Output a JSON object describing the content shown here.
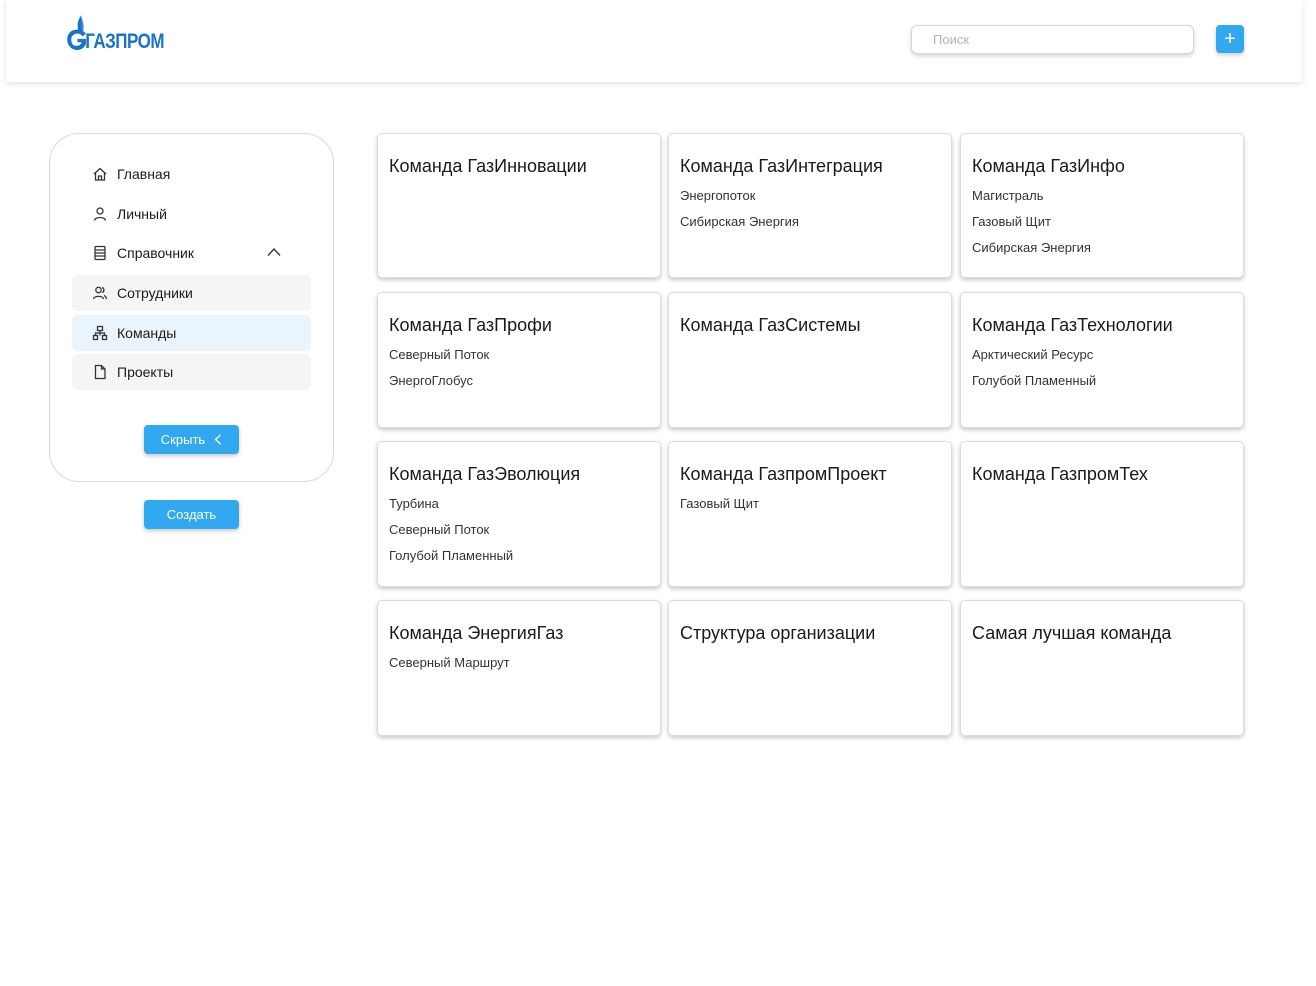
{
  "header": {
    "logo_text": "ГАЗПРОМ",
    "search_placeholder": "Поиск",
    "add_label": "+"
  },
  "sidebar": {
    "items": [
      {
        "label": "Главная",
        "icon": "home-icon"
      },
      {
        "label": "Личный",
        "icon": "user-icon"
      },
      {
        "label": "Справочник",
        "icon": "directory-icon",
        "expanded": true
      },
      {
        "label": "Сотрудники",
        "icon": "employees-icon"
      },
      {
        "label": "Команды",
        "icon": "teams-icon",
        "active": true
      },
      {
        "label": "Проекты",
        "icon": "file-icon"
      }
    ],
    "hide_label": "Скрыть",
    "create_label": "Создать"
  },
  "cards": [
    {
      "title": "Команда ГазИнновации",
      "items": []
    },
    {
      "title": "Команда ГазИнтеграция",
      "items": [
        "Энергопоток",
        "Сибирская Энергия"
      ]
    },
    {
      "title": "Команда ГазИнфо",
      "items": [
        "Магистраль",
        "Газовый Щит",
        "Сибирская Энергия"
      ]
    },
    {
      "title": "Команда ГазПрофи",
      "items": [
        "Северный Поток",
        "ЭнергоГлобус"
      ]
    },
    {
      "title": "Команда ГазСистемы",
      "items": []
    },
    {
      "title": "Команда ГазТехнологии",
      "items": [
        "Арктический Ресурс",
        "Голубой Пламенный"
      ]
    },
    {
      "title": "Команда ГазЭволюция",
      "items": [
        "Турбина",
        "Северный Поток",
        "Голубой Пламенный"
      ]
    },
    {
      "title": "Команда ГазпромПроект",
      "items": [
        "Газовый Щит"
      ]
    },
    {
      "title": "Команда ГазпромТех",
      "items": []
    },
    {
      "title": "Команда ЭнергияГаз",
      "items": [
        "Северный Маршрут"
      ]
    },
    {
      "title": "Структура организации",
      "items": []
    },
    {
      "title": "Самая лучшая команда",
      "items": []
    }
  ],
  "colors": {
    "accent": "#31a8f0",
    "brand": "#1a73c7",
    "active_nav_bg": "#e9f4fd"
  }
}
